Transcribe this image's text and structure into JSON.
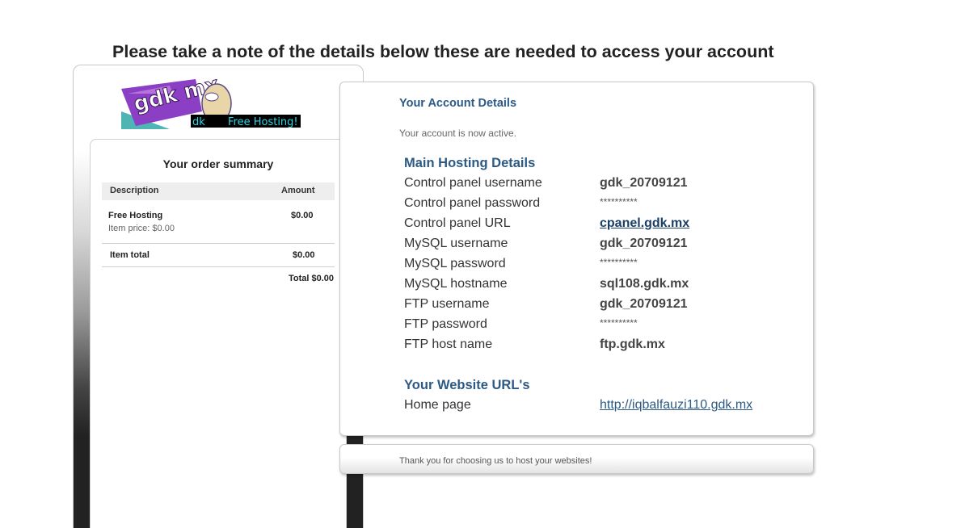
{
  "headline": "Please take a note of the details below these are needed to access your account",
  "logo": {
    "alt": "gdk.mx Free Hosting",
    "wordmark": "gdk mx",
    "tagline": "Free Hosting!",
    "prefix": "dk"
  },
  "order_summary": {
    "title": "Your order summary",
    "columns": {
      "description": "Description",
      "amount": "Amount"
    },
    "item": {
      "name": "Free Hosting",
      "price": "Item price: $0.00",
      "amount": "$0.00"
    },
    "item_total_label": "Item total",
    "item_total_amount": "$0.00",
    "grand_total": "Total $0.00"
  },
  "account": {
    "title": "Your Account Details",
    "status": "Your account is now active."
  },
  "hosting": {
    "heading": "Main Hosting Details",
    "rows": [
      {
        "label": "Control panel username",
        "value": "gdk_20709121"
      },
      {
        "label": "Control panel password",
        "value": "**********"
      },
      {
        "label": "Control panel URL",
        "value": "cpanel.gdk.mx"
      },
      {
        "label": "MySQL username",
        "value": "gdk_20709121"
      },
      {
        "label": "MySQL password",
        "value": "**********"
      },
      {
        "label": "MySQL hostname",
        "value": "sql108.gdk.mx"
      },
      {
        "label": "FTP username",
        "value": "gdk_20709121"
      },
      {
        "label": "FTP password",
        "value": "**********"
      },
      {
        "label": "FTP host name",
        "value": "ftp.gdk.mx"
      }
    ]
  },
  "website": {
    "heading": "Your Website URL's",
    "home_label": "Home page",
    "home_url": "http://iqbalfauzi110.gdk.mx"
  },
  "footer": "Thank you for choosing us to host your websites!",
  "colors": {
    "heading_blue": "#2c5a85",
    "logo_purple": "#8b3fc4",
    "logo_teal": "#4fb4b4",
    "logo_cyan": "#28d7e6"
  }
}
